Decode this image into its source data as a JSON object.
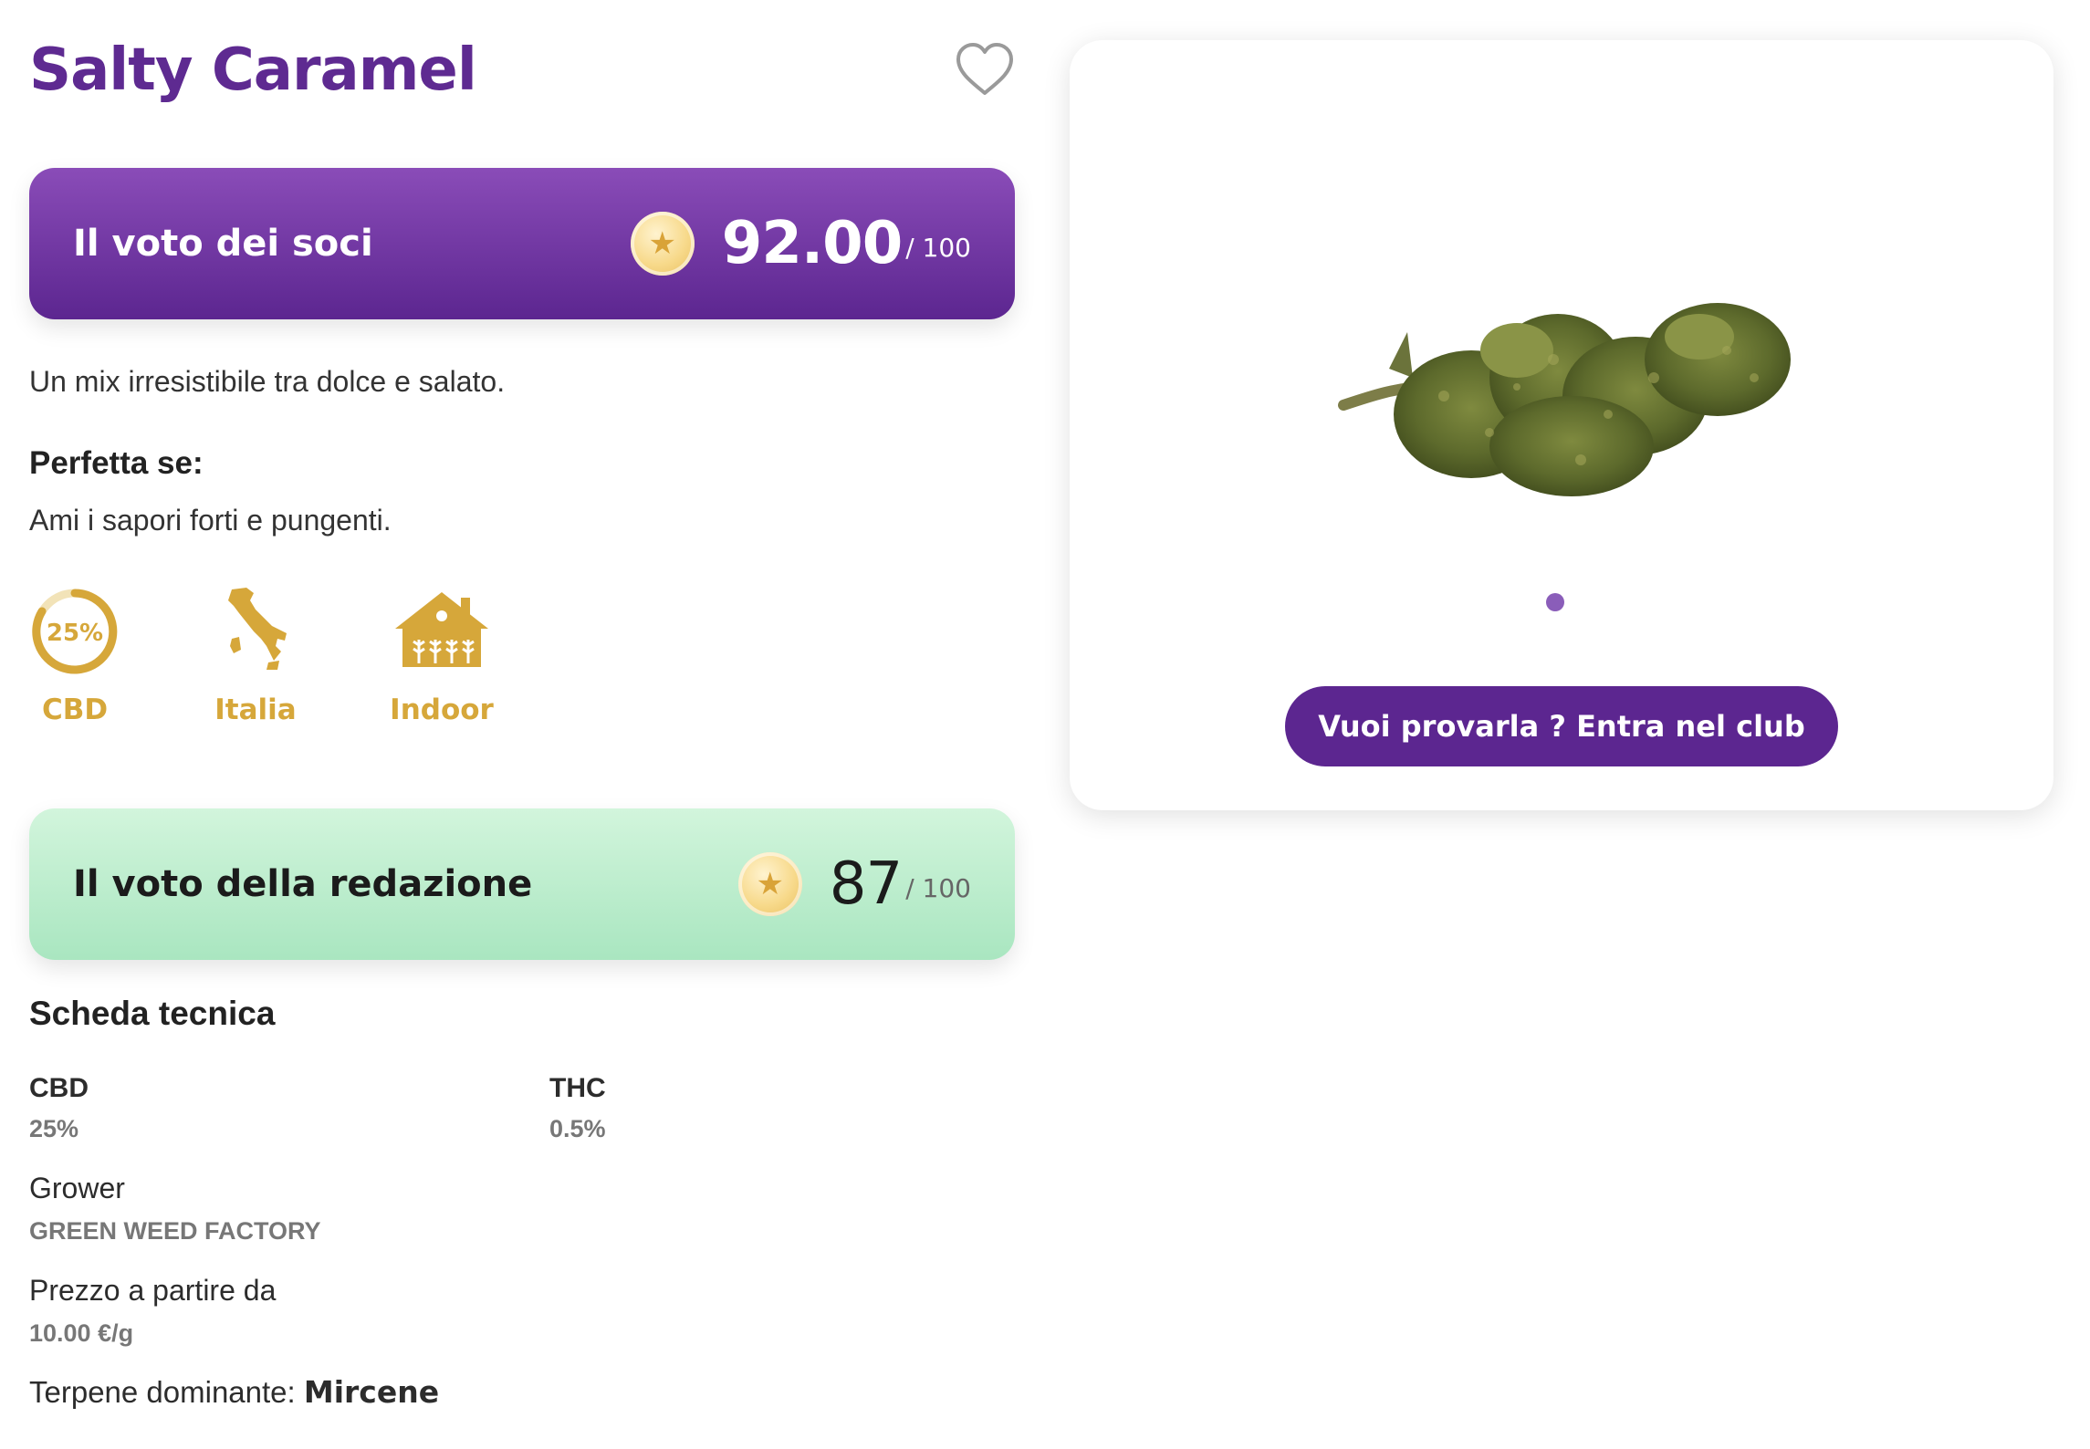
{
  "product": {
    "name": "Salty Caramel",
    "description": "Un mix irresistibile tra dolce e salato.",
    "ideal_heading": "Perfetta se:",
    "ideal_text": "Ami i sapori forti e pungenti."
  },
  "member_score": {
    "label": "Il voto dei soci",
    "value": "92.00",
    "max": "/ 100"
  },
  "editor_score": {
    "label": "Il voto della redazione",
    "value": "87",
    "max": "/ 100"
  },
  "features": [
    {
      "icon": "percentage-ring-icon",
      "badge": "25%",
      "label": "CBD"
    },
    {
      "icon": "italy-map-icon",
      "label": "Italia"
    },
    {
      "icon": "indoor-greenhouse-icon",
      "label": "Indoor"
    }
  ],
  "specs": {
    "heading": "Scheda tecnica",
    "cbd_label": "CBD",
    "cbd_value": "25%",
    "thc_label": "THC",
    "thc_value": "0.5%",
    "grower_label": "Grower",
    "grower_value": "GREEN WEED FACTORY",
    "price_label": "Prezzo a partire da",
    "price_value": "10.00 €/g",
    "terpene_label": "Terpene dominante: ",
    "terpene_value": "Mircene"
  },
  "gallery": {
    "image": "cannabis-bud-photo",
    "slide_count": 1
  },
  "cta": {
    "label": "Vuoi provarla ? Entra nel club"
  },
  "colors": {
    "brand_purple": "#5e2a91",
    "gold": "#d6a73a",
    "mint": "#bff0cf"
  }
}
